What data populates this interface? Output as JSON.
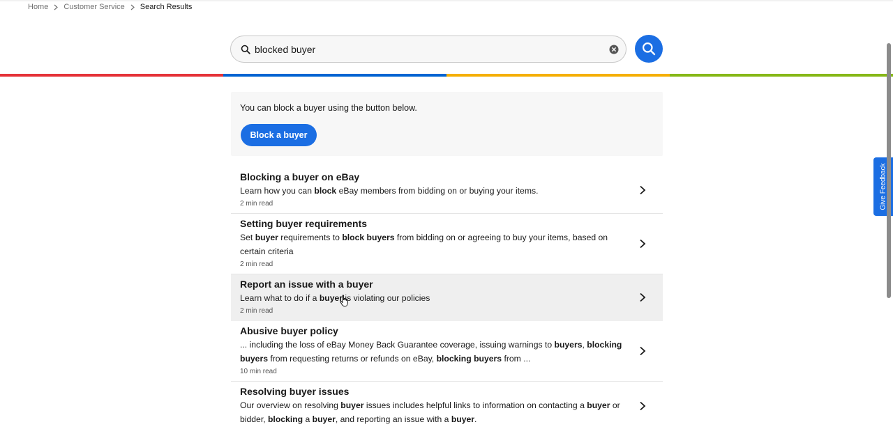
{
  "breadcrumb": {
    "items": [
      "Home",
      "Customer Service",
      "Search Results"
    ]
  },
  "search": {
    "value": "blocked buyer",
    "placeholder": ""
  },
  "colors": {
    "accent": "#1b6ee3",
    "bar": [
      "#e53238",
      "#0064d2",
      "#f5af02",
      "#86b817"
    ]
  },
  "block_panel": {
    "message": "You can block a buyer using the button below.",
    "button_label": "Block a buyer"
  },
  "results": [
    {
      "title": "Blocking a buyer on eBay",
      "desc_parts": [
        [
          "Learn how you can ",
          false
        ],
        [
          "block",
          true
        ],
        [
          " eBay members from bidding on or buying your items.",
          false
        ]
      ],
      "meta": "2 min read"
    },
    {
      "title": "Setting buyer requirements",
      "desc_parts": [
        [
          "Set ",
          false
        ],
        [
          "buyer",
          true
        ],
        [
          " requirements to ",
          false
        ],
        [
          "block buyers",
          true
        ],
        [
          " from bidding on or agreeing to buy your items, based on certain criteria",
          false
        ]
      ],
      "meta": "2 min read"
    },
    {
      "title": "Report an issue with a buyer",
      "desc_parts": [
        [
          "Learn what to do if a ",
          false
        ],
        [
          "buyer",
          true
        ],
        [
          " is violating our policies",
          false
        ]
      ],
      "meta": "2 min read"
    },
    {
      "title": "Abusive buyer policy",
      "desc_parts": [
        [
          "... including the loss of eBay Money Back Guarantee coverage, issuing warnings to ",
          false
        ],
        [
          "buyers",
          true
        ],
        [
          ", ",
          false
        ],
        [
          "blocking buyers",
          true
        ],
        [
          " from requesting returns or refunds on eBay, ",
          false
        ],
        [
          "blocking buyers",
          true
        ],
        [
          " from ...",
          false
        ]
      ],
      "meta": "10 min read"
    },
    {
      "title": "Resolving buyer issues",
      "desc_parts": [
        [
          "Our overview on resolving ",
          false
        ],
        [
          "buyer",
          true
        ],
        [
          " issues includes helpful links to information on contacting a ",
          false
        ],
        [
          "buyer",
          true
        ],
        [
          " or bidder, ",
          false
        ],
        [
          "blocking",
          true
        ],
        [
          " a ",
          false
        ],
        [
          "buyer",
          true
        ],
        [
          ", and reporting an issue with a ",
          false
        ],
        [
          "buyer",
          true
        ],
        [
          ".",
          false
        ]
      ],
      "meta": ""
    }
  ],
  "feedback": {
    "label": "Give Feedback"
  }
}
